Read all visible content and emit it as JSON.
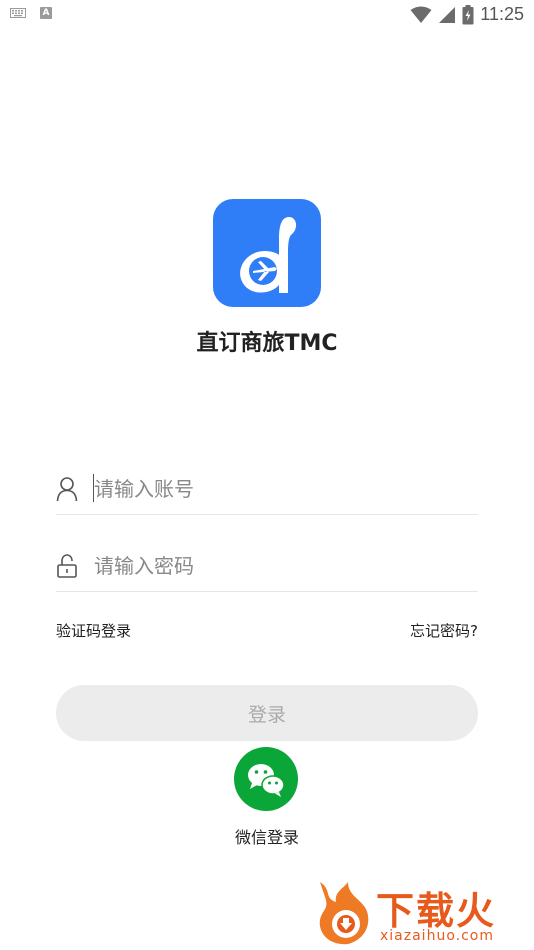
{
  "status_bar": {
    "time": "11:25",
    "icons": [
      "keyboard-icon",
      "a-icon",
      "wifi-icon",
      "signal-icon",
      "battery-icon"
    ]
  },
  "app": {
    "name": "直订商旅TMC",
    "brand_color": "#2f7ef7"
  },
  "form": {
    "account": {
      "placeholder": "请输入账号",
      "value": ""
    },
    "password": {
      "placeholder": "请输入密码",
      "value": ""
    },
    "sms_login_label": "验证码登录",
    "forgot_password_label": "忘记密码?",
    "login_button_label": "登录"
  },
  "wechat": {
    "label": "微信登录",
    "color": "#0aa637"
  },
  "watermark": {
    "text": "下载火",
    "subtext": "xiazaihuo.com",
    "color": "#e85a1c"
  }
}
